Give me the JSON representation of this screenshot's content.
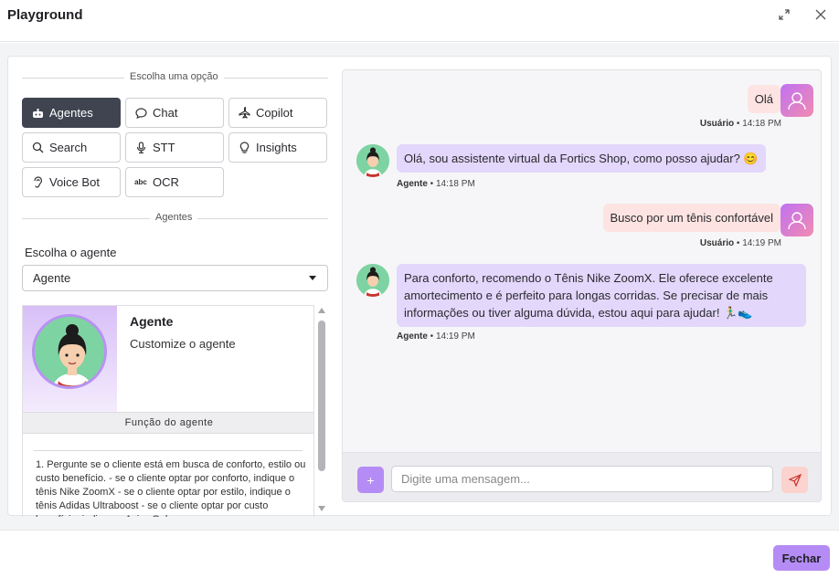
{
  "header": {
    "title": "Playground",
    "expand_icon": "expand-icon",
    "close_icon": "close-icon"
  },
  "options": {
    "section_label": "Escolha uma opção",
    "items": [
      {
        "label": "Agentes",
        "icon": "robot-icon",
        "active": true
      },
      {
        "label": "Chat",
        "icon": "chat-bubble-icon"
      },
      {
        "label": "Copilot",
        "icon": "airplane-icon"
      },
      {
        "label": "Search",
        "icon": "search-icon"
      },
      {
        "label": "STT",
        "icon": "microphone-icon"
      },
      {
        "label": "Insights",
        "icon": "lightbulb-icon"
      },
      {
        "label": "Voice Bot",
        "icon": "ear-icon"
      },
      {
        "label": "OCR",
        "icon": "abc-text-icon"
      }
    ],
    "abc_glyph": "abc"
  },
  "agents": {
    "section_label": "Agentes",
    "choose_label": "Escolha o agente",
    "selected": "Agente",
    "card": {
      "name": "Agente",
      "subtitle": "Customize o agente",
      "function_title": "Função do agente",
      "function_text": "1. Pergunte se o cliente está em busca de conforto, estilo ou custo benefício. - se o cliente optar por conforto, indique o tênis Nike ZoomX - se o cliente optar por estilo, indique o tênis Adidas Ultraboost - se o cliente optar por custo benefício, indique o Asics Gel"
    }
  },
  "chat": {
    "messages": [
      {
        "role": "user",
        "text": "Olá",
        "sender": "Usuário",
        "time": "14:18 PM"
      },
      {
        "role": "agent",
        "text": "Olá, sou assistente virtual da Fortics Shop, como posso ajudar? 😊",
        "sender": "Agente",
        "time": "14:18 PM"
      },
      {
        "role": "user",
        "text": "Busco por um tênis confortável",
        "sender": "Usuário",
        "time": "14:19 PM"
      },
      {
        "role": "agent",
        "text": "Para conforto, recomendo o Tênis Nike ZoomX. Ele oferece excelente amortecimento e é perfeito para longas corridas. Se precisar de mais informações ou tiver alguma dúvida, estou aqui para ajudar! 🏃‍♂️👟",
        "sender": "Agente",
        "time": "14:19 PM"
      }
    ],
    "meta_separator": " • ",
    "input_placeholder": "Digite uma mensagem...",
    "plus_label": "+"
  },
  "footer": {
    "close_button": "Fechar"
  },
  "colors": {
    "accent": "#b58cf5",
    "user_bubble": "#fde4e2",
    "agent_bubble": "#e3d7fb",
    "active_option": "#3f4450"
  }
}
